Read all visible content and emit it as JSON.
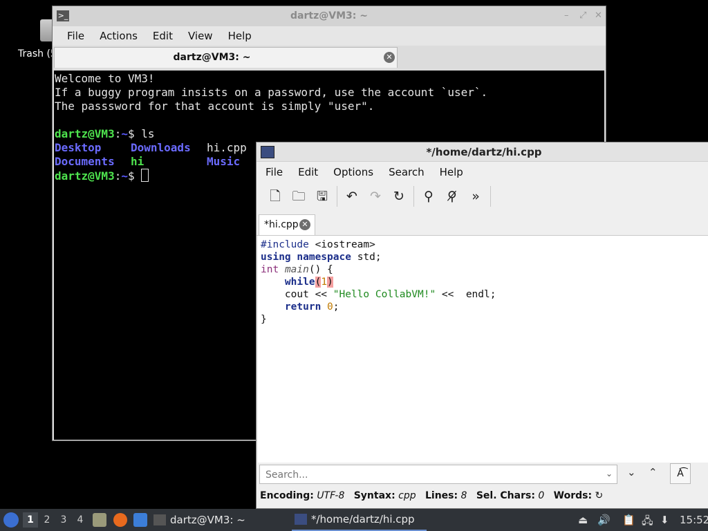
{
  "desktop": {
    "trash_label": "Trash (5"
  },
  "terminal": {
    "title": "dartz@VM3: ~",
    "menu": [
      "File",
      "Actions",
      "Edit",
      "View",
      "Help"
    ],
    "tab_label": "dartz@VM3: ~",
    "lines": {
      "l1": "Welcome to VM3!",
      "l2": "If a buggy program insists on a password, use the account `user`.",
      "l3": "The passsword for that account is simply \"user\".",
      "prompt_user": "dartz@VM3",
      "prompt_sep": ":",
      "prompt_path": "~",
      "prompt_dollar": "$ ",
      "cmd": "ls"
    },
    "ls": {
      "desktop": "Desktop",
      "downloads": "Downloads",
      "hicpp": "hi.cpp",
      "documents": "Documents",
      "hi": "hi",
      "music": "Music"
    }
  },
  "editor": {
    "title": "*/home/dartz/hi.cpp",
    "menu": [
      "File",
      "Edit",
      "Options",
      "Search",
      "Help"
    ],
    "tab_label": "*hi.cpp",
    "code": {
      "include": "#include",
      "header": " <iostream>",
      "using": "using",
      "namespace": "namespace",
      "std": " std;",
      "int": "int",
      "main": "main",
      "main_rest": "() {",
      "indent": "    ",
      "while": "while",
      "lparen": "(",
      "one": "1",
      "rparen": ")",
      "cout": "cout << ",
      "hello": "\"Hello CollabVM!\"",
      "endl": " <<  endl;",
      "return": "return",
      "zero": "0",
      "semi": ";",
      "close": "}"
    },
    "search_placeholder": "Search...",
    "status": {
      "encoding_label": "Encoding:",
      "encoding": "UTF-8",
      "syntax_label": "Syntax:",
      "syntax": "cpp",
      "lines_label": "Lines:",
      "lines": "8",
      "sel_label": "Sel. Chars:",
      "sel": "0",
      "words_label": "Words:"
    }
  },
  "taskbar": {
    "workspaces": [
      "1",
      "2",
      "3",
      "4"
    ],
    "task_terminal": "dartz@VM3: ~",
    "task_editor": "*/home/dartz/hi.cpp",
    "clock": "15:52"
  }
}
